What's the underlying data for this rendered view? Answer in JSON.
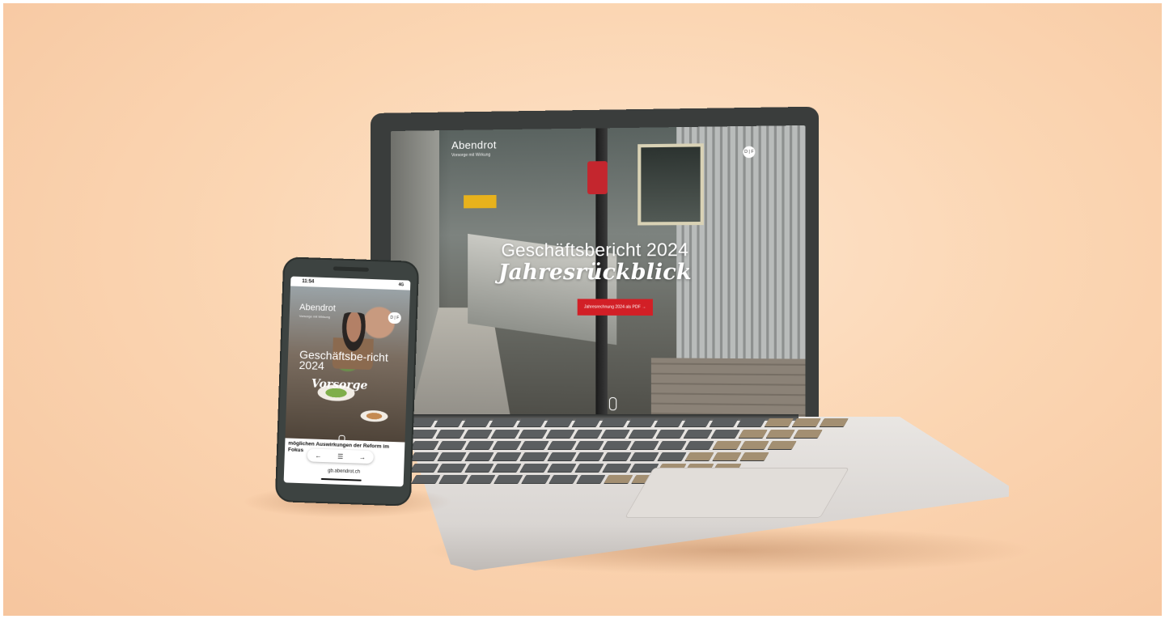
{
  "laptop_site": {
    "logo": "Abendrot",
    "logo_tagline": "Vorsorge mit Wirkung",
    "lang_toggle": "D | F",
    "title_line1": "Geschäftsbericht 2024",
    "title_line2": "Jahresrückblick",
    "cta_label": "Jahresrechnung 2024 als PDF →"
  },
  "phone_site": {
    "status_time": "11:54",
    "status_icons": "4G",
    "logo": "Abendrot",
    "logo_tagline": "Vorsorge mit Wirkung",
    "lang_toggle": "D | F",
    "title": "Geschäftsbe-richt 2024",
    "title_italic": "Vorsorge",
    "teaser_text": "möglichen Auswirkungen der Reform im Fokus",
    "nav_prev": "←",
    "nav_menu": "☰",
    "nav_next": "→",
    "url": "gb.abendrot.ch"
  },
  "colors": {
    "background": "#fbd6b3",
    "accent_red": "#d21f26",
    "device_frame": "#3d4341"
  }
}
